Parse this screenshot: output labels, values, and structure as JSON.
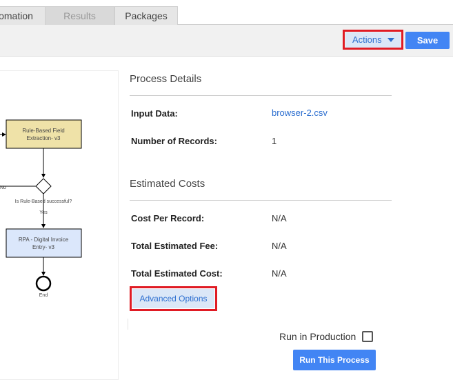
{
  "tabs": [
    {
      "label": "omation",
      "state": "inactive"
    },
    {
      "label": "Results",
      "state": "disabled"
    },
    {
      "label": "Packages",
      "state": "inactive"
    }
  ],
  "toolbar": {
    "actions_label": "Actions",
    "save_label": "Save"
  },
  "diagram": {
    "node1": "Rule-Based Field Extraction- v3",
    "node1_line1": "Rule-Based Field",
    "node1_line2": "Extraction- v3",
    "decision_label": "Is Rule-Based successful?",
    "no_label": "No",
    "yes_label": "Yes",
    "node2_line1": "RPA - Digital Invoice",
    "node2_line2": "Entry- v3",
    "end_label": "End"
  },
  "process_details": {
    "title": "Process Details",
    "input_data_label": "Input Data:",
    "input_data_value": "browser-2.csv",
    "records_label": "Number of Records:",
    "records_value": "1"
  },
  "estimated_costs": {
    "title": "Estimated Costs",
    "cost_per_record_label": "Cost Per Record:",
    "cost_per_record_value": "N/A",
    "total_fee_label": "Total Estimated Fee:",
    "total_fee_value": "N/A",
    "total_cost_label": "Total Estimated Cost:",
    "total_cost_value": "N/A"
  },
  "advanced_options_label": "Advanced Options",
  "run": {
    "production_label": "Run in Production",
    "production_checked": false,
    "run_button_label": "Run This Process"
  },
  "colors": {
    "accent": "#4285f4",
    "highlight": "#e01b24",
    "node1_fill": "#efe2a8",
    "node2_fill": "#dbe7fb"
  }
}
